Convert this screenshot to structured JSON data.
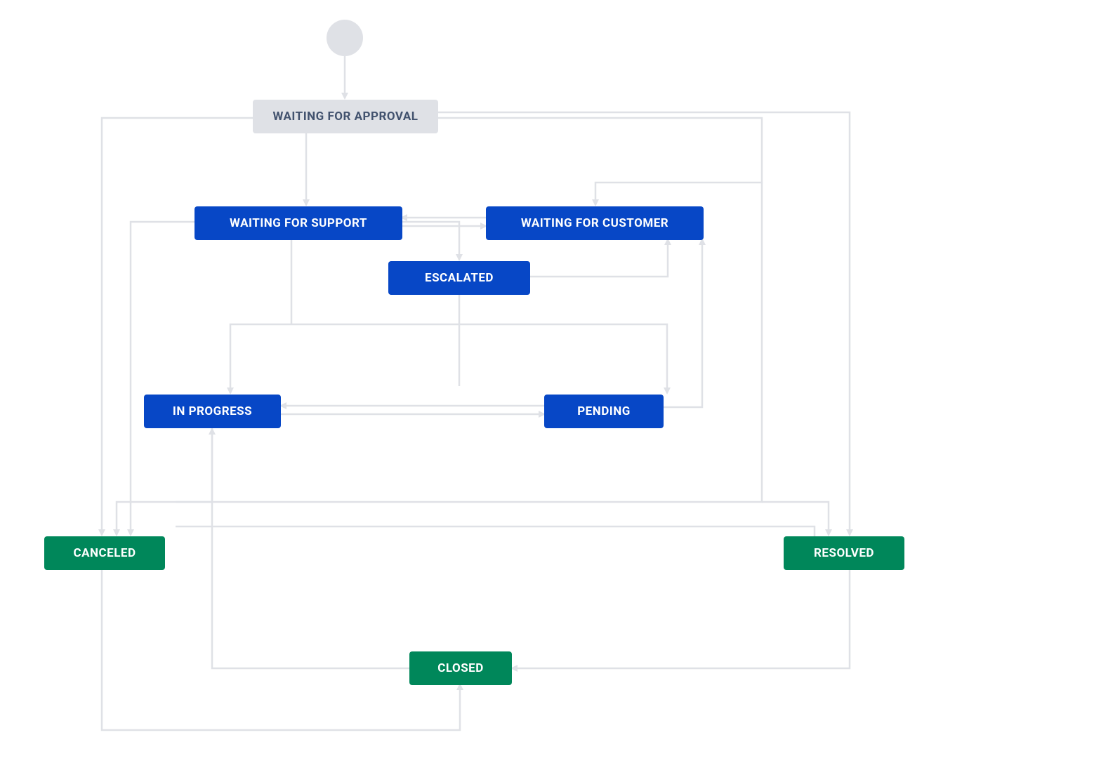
{
  "colors": {
    "gray_bg": "#dfe1e6",
    "gray_text": "#42526e",
    "blue_bg": "#0747c6",
    "green_bg": "#00875a",
    "edge": "#dfe1e6"
  },
  "nodes": {
    "start": {
      "type": "start"
    },
    "waiting_approval": {
      "label": "WAITING FOR APPROVAL",
      "style": "gray"
    },
    "waiting_support": {
      "label": "WAITING FOR SUPPORT",
      "style": "blue"
    },
    "waiting_customer": {
      "label": "WAITING FOR CUSTOMER",
      "style": "blue"
    },
    "escalated": {
      "label": "ESCALATED",
      "style": "blue"
    },
    "in_progress": {
      "label": "IN PROGRESS",
      "style": "blue"
    },
    "pending": {
      "label": "PENDING",
      "style": "blue"
    },
    "canceled": {
      "label": "CANCELED",
      "style": "green"
    },
    "resolved": {
      "label": "RESOLVED",
      "style": "green"
    },
    "closed": {
      "label": "CLOSED",
      "style": "green"
    }
  },
  "edges": [
    [
      "start",
      "waiting_approval"
    ],
    [
      "waiting_approval",
      "waiting_support"
    ],
    [
      "waiting_approval",
      "waiting_customer"
    ],
    [
      "waiting_approval",
      "canceled"
    ],
    [
      "waiting_approval",
      "resolved"
    ],
    [
      "waiting_support",
      "waiting_customer"
    ],
    [
      "waiting_customer",
      "waiting_support"
    ],
    [
      "waiting_support",
      "escalated"
    ],
    [
      "waiting_customer",
      "escalated"
    ],
    [
      "waiting_support",
      "in_progress"
    ],
    [
      "waiting_support",
      "pending"
    ],
    [
      "waiting_support",
      "canceled"
    ],
    [
      "waiting_customer",
      "in_progress"
    ],
    [
      "waiting_customer",
      "pending"
    ],
    [
      "waiting_customer",
      "resolved"
    ],
    [
      "escalated",
      "in_progress"
    ],
    [
      "escalated",
      "pending"
    ],
    [
      "escalated",
      "waiting_customer"
    ],
    [
      "in_progress",
      "pending"
    ],
    [
      "pending",
      "in_progress"
    ],
    [
      "pending",
      "waiting_customer"
    ],
    [
      "in_progress",
      "canceled"
    ],
    [
      "in_progress",
      "resolved"
    ],
    [
      "canceled",
      "closed"
    ],
    [
      "resolved",
      "closed"
    ],
    [
      "closed",
      "in_progress"
    ]
  ]
}
